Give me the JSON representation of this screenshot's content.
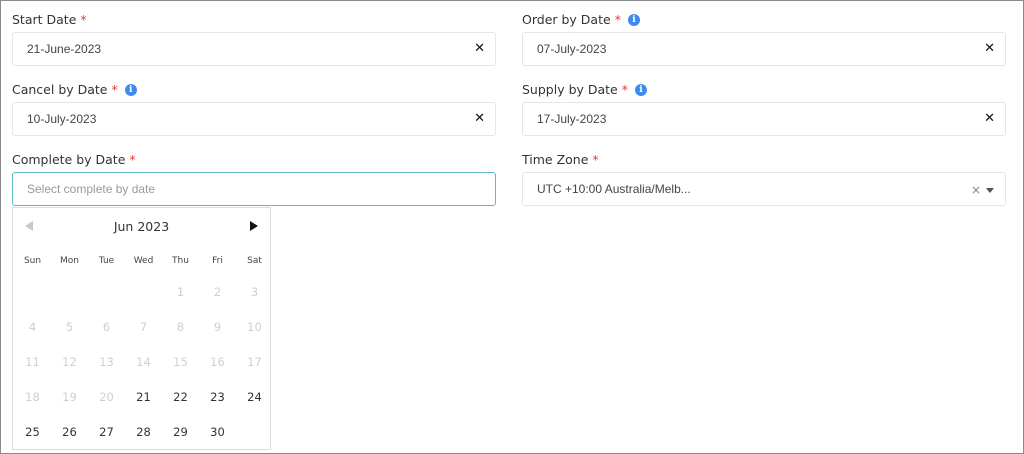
{
  "form": {
    "start_date": {
      "label": "Start Date",
      "required": "*",
      "value": "21-June-2023",
      "clear": "✕"
    },
    "order_by_date": {
      "label": "Order by Date",
      "required": "*",
      "info": "i",
      "value": "07-July-2023",
      "clear": "✕"
    },
    "cancel_by_date": {
      "label": "Cancel by Date",
      "required": "*",
      "info": "i",
      "value": "10-July-2023",
      "clear": "✕"
    },
    "supply_by_date": {
      "label": "Supply by Date",
      "required": "*",
      "info": "i",
      "value": "17-July-2023",
      "clear": "✕"
    },
    "complete_by_date": {
      "label": "Complete by Date",
      "required": "*",
      "placeholder": "Select complete by date",
      "value": ""
    },
    "time_zone": {
      "label": "Time Zone",
      "required": "*",
      "value": "UTC +10:00 Australia/Melb...",
      "clear": "×"
    }
  },
  "calendar": {
    "month_label": "Jun 2023",
    "weekdays": [
      "Sun",
      "Mon",
      "Tue",
      "Wed",
      "Thu",
      "Fri",
      "Sat"
    ],
    "weeks": [
      [
        null,
        null,
        null,
        null,
        1,
        2,
        3
      ],
      [
        4,
        5,
        6,
        7,
        8,
        9,
        10
      ],
      [
        11,
        12,
        13,
        14,
        15,
        16,
        17
      ],
      [
        18,
        19,
        20,
        21,
        22,
        23,
        24
      ],
      [
        25,
        26,
        27,
        28,
        29,
        30,
        null
      ]
    ],
    "first_enabled_day": 21
  },
  "colors": {
    "required": "#e53935",
    "info": "#3d8bf0",
    "focus_border": "#5fb8c9",
    "disabled_day": "#cfcfcf"
  }
}
